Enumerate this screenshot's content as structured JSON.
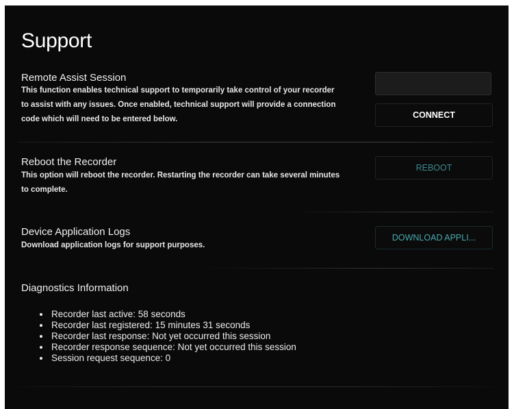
{
  "page": {
    "title": "Support"
  },
  "remote_assist": {
    "heading": "Remote Assist Session",
    "description": "This function enables technical support to temporarily take control of your recorder to assist with any issues. Once enabled, technical support will provide a connection code which will need to be entered below.",
    "code_input_value": "",
    "connect_label": "CONNECT"
  },
  "reboot": {
    "heading": "Reboot the Recorder",
    "description": "This option will reboot the recorder. Restarting the recorder can take several minutes to complete.",
    "button_label": "REBOOT"
  },
  "logs": {
    "heading": "Device Application Logs",
    "description": "Download application logs for support purposes.",
    "button_label": "DOWNLOAD APPLI..."
  },
  "diagnostics": {
    "heading": "Diagnostics Information",
    "items": [
      "Recorder last active: 58 seconds",
      "Recorder last registered: 15 minutes 31 seconds",
      "Recorder last response: Not yet occurred this session",
      "Recorder response sequence: Not yet occurred this session",
      "Session request sequence: 0"
    ]
  },
  "colors": {
    "panel_background": "#0a0a0a",
    "text": "#ececec",
    "accent_teal": "#48a9b0",
    "divider": "#3a3a3a"
  }
}
